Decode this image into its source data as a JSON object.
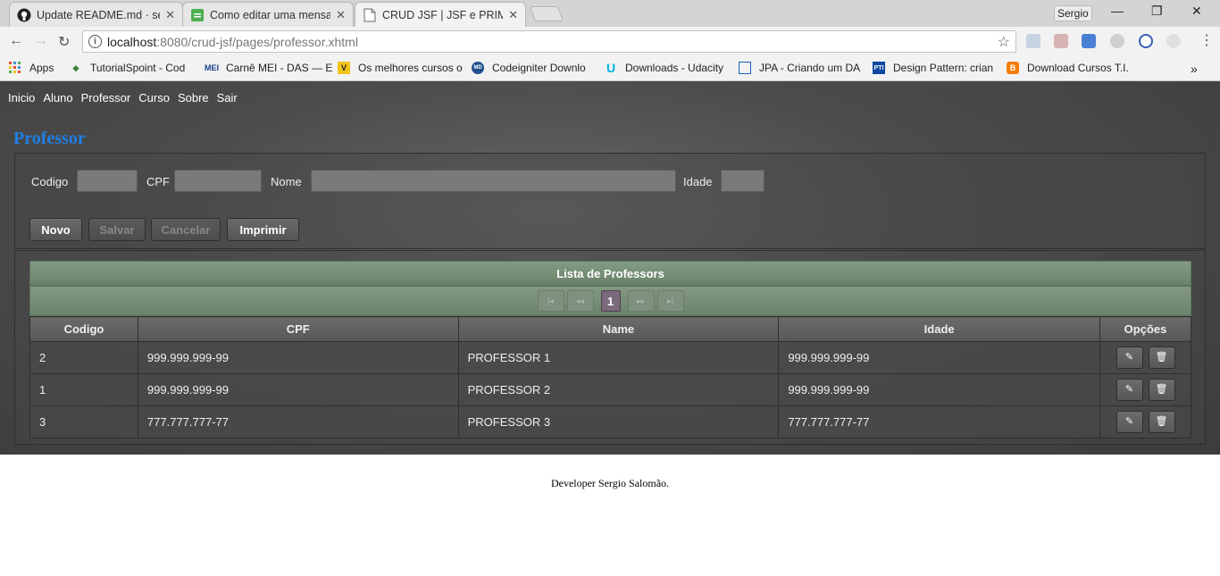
{
  "browser": {
    "tabs": [
      {
        "title": "Update README.md · ser",
        "icon": "github-icon"
      },
      {
        "title": "Como editar uma mensag",
        "icon": "stackoverflow-icon"
      },
      {
        "title": "CRUD JSF | JSF e PRIMEFA",
        "icon": "page-icon"
      }
    ],
    "user": "Sergio",
    "url_host": "localhost",
    "url_path": ":8080/crud-jsf/pages/professor.xhtml",
    "bookmarks": [
      {
        "label": "Apps",
        "color": "#e94b35"
      },
      {
        "label": "TutorialSpoint - Cod",
        "color": "#2e7d32"
      },
      {
        "label": "Carnê MEI - DAS — E",
        "color": "#1a3e8c"
      },
      {
        "label": "Os melhores cursos o",
        "color": "#f0c419"
      },
      {
        "label": "Codeigniter Downlo",
        "color": "#1f4e8c"
      },
      {
        "label": "Downloads - Udacity",
        "color": "#02b3e4"
      },
      {
        "label": "JPA - Criando um DA",
        "color": "#1565c0"
      },
      {
        "label": "Design Pattern: crian",
        "color": "#0d47a1"
      },
      {
        "label": "Download Cursos T.I.",
        "color": "#f57c00"
      }
    ],
    "more": "»"
  },
  "menu": [
    "Inicio",
    "Aluno",
    "Professor",
    "Curso",
    "Sobre",
    "Sair"
  ],
  "page_title": "Professor",
  "form": {
    "codigo_label": "Codigo",
    "cpf_label": "CPF",
    "nome_label": "Nome",
    "idade_label": "Idade",
    "buttons": {
      "novo": "Novo",
      "salvar": "Salvar",
      "cancelar": "Cancelar",
      "imprimir": "Imprimir"
    }
  },
  "table": {
    "caption": "Lista de Professors",
    "current_page": "1",
    "columns": [
      "Codigo",
      "CPF",
      "Name",
      "Idade",
      "Opções"
    ],
    "rows": [
      {
        "codigo": "2",
        "cpf": "999.999.999-99",
        "name": "PROFESSOR 1",
        "idade": "999.999.999-99"
      },
      {
        "codigo": "1",
        "cpf": "999.999.999-99",
        "name": "PROFESSOR 2",
        "idade": "999.999.999-99"
      },
      {
        "codigo": "3",
        "cpf": "777.777.777-77",
        "name": "PROFESSOR 3",
        "idade": "777.777.777-77"
      }
    ]
  },
  "footer": "Developer Sergio Salomão.",
  "colors": {
    "title": "#1f7fe6",
    "table_header": "#7a917a",
    "background": "#4c4c4c"
  }
}
